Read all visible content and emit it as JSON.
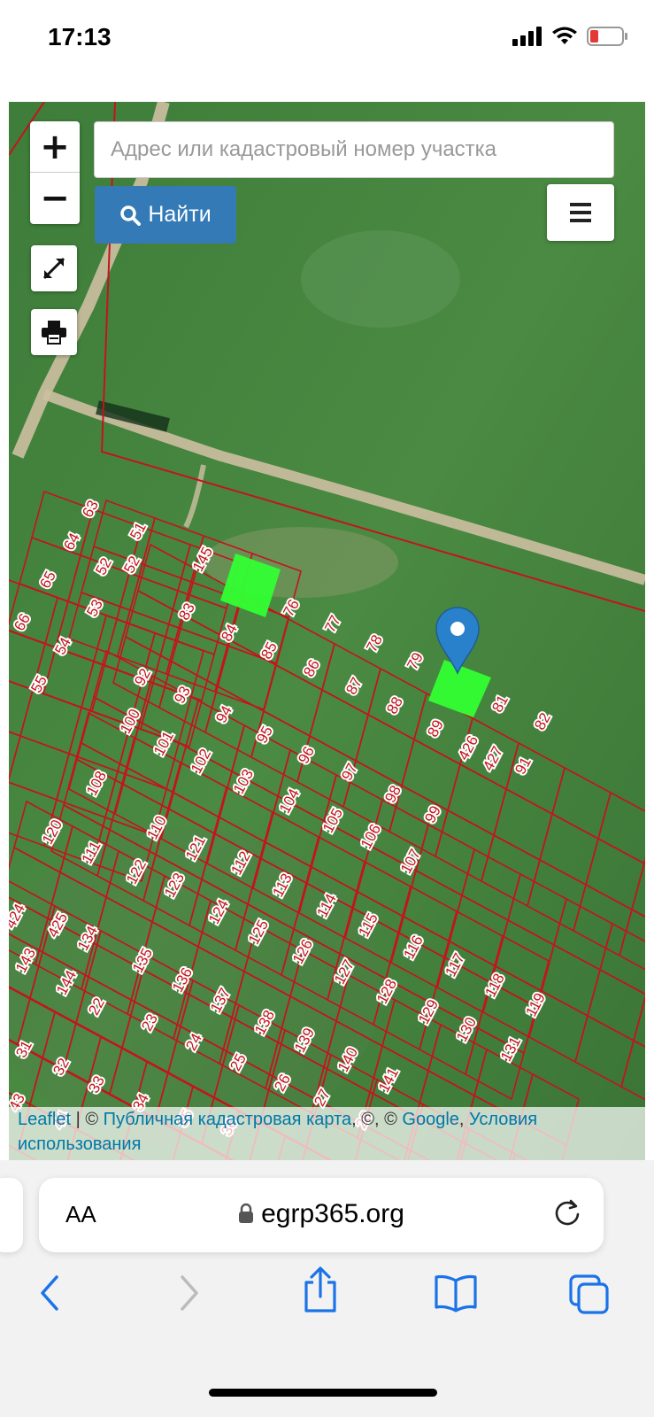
{
  "status_bar": {
    "time": "17:13",
    "battery_color": "#e53935"
  },
  "map": {
    "search_placeholder": "Адрес или кадастровый номер участка",
    "find_label": "Найти",
    "zoom_in_label": "+",
    "zoom_out_label": "−",
    "highlight_color": "#33ff33",
    "boundary_color": "#c4141c",
    "marker_color": "#2a81cb",
    "parcel_labels": [
      "63",
      "51",
      "64",
      "52",
      "52",
      "65",
      "53",
      "66",
      "54",
      "55",
      "145",
      "76",
      "83",
      "84",
      "85",
      "86",
      "77",
      "78",
      "79",
      "87",
      "88",
      "81",
      "82",
      "89",
      "426",
      "427",
      "91",
      "92",
      "93",
      "100",
      "94",
      "101",
      "95",
      "96",
      "102",
      "103",
      "97",
      "104",
      "98",
      "105",
      "99",
      "106",
      "107",
      "108",
      "110",
      "120",
      "111",
      "121",
      "112",
      "122",
      "123",
      "113",
      "124",
      "114",
      "115",
      "125",
      "126",
      "116",
      "424",
      "425",
      "117",
      "134",
      "127",
      "135",
      "128",
      "143",
      "136",
      "118",
      "119",
      "144",
      "22",
      "137",
      "129",
      "138",
      "130",
      "23",
      "139",
      "131",
      "24",
      "140",
      "25",
      "141",
      "26",
      "31",
      "32",
      "33",
      "27",
      "34",
      "35",
      "36",
      "28",
      "43",
      "44"
    ]
  },
  "attribution": {
    "leaflet": "Leaflet",
    "sep1": " | © ",
    "cadastre": "Публичная кадастровая карта",
    "sep2": ", ©, © ",
    "google": "Google",
    "sep3": ", ",
    "terms": "Условия использования"
  },
  "browser": {
    "text_size_label": "AA",
    "url": "egrp365.org"
  }
}
